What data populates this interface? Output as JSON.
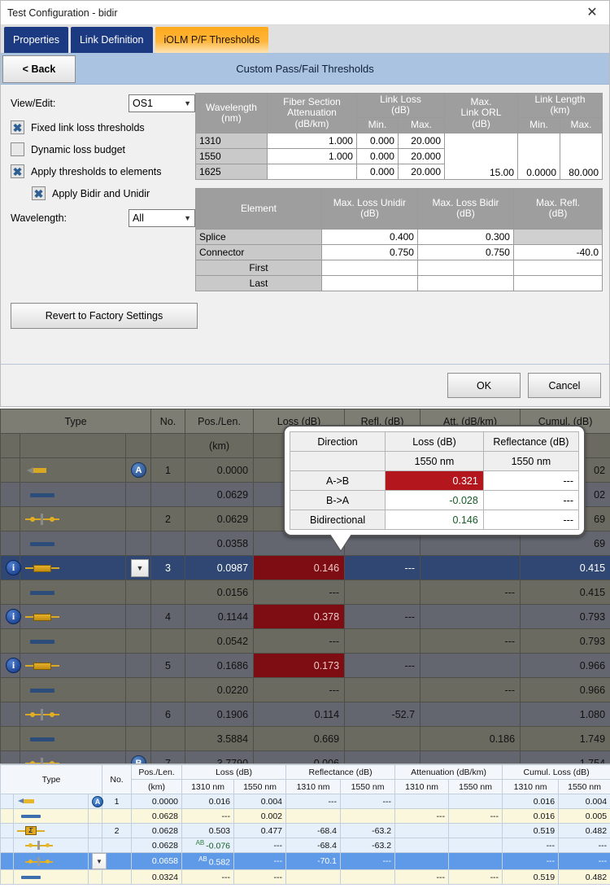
{
  "dialog": {
    "title": "Test Configuration - bidir",
    "close_icon": "close-icon",
    "tabs": [
      {
        "label": "Properties",
        "active": false
      },
      {
        "label": "Link Definition",
        "active": false
      },
      {
        "label": "iOLM P/F Thresholds",
        "active": true
      }
    ],
    "back_label": "< Back",
    "section_title": "Custom Pass/Fail Thresholds",
    "left": {
      "view_edit_label": "View/Edit:",
      "view_edit_value": "OS1",
      "checkboxes": [
        {
          "label": "Fixed link loss thresholds",
          "checked": true,
          "indent": false
        },
        {
          "label": "Dynamic loss budget",
          "checked": false,
          "indent": false
        },
        {
          "label": "Apply thresholds to elements",
          "checked": true,
          "indent": false
        },
        {
          "label": "Apply Bidir and Unidir",
          "checked": true,
          "indent": true
        }
      ],
      "wavelength_label": "Wavelength:",
      "wavelength_value": "All"
    },
    "threshold_table": {
      "headers": {
        "wavelength": "Wavelength\n(nm)",
        "wavelength_l1": "Wavelength",
        "wavelength_l2": "(nm)",
        "fiber_l1": "Fiber Section",
        "fiber_l2": "Attenuation",
        "fiber_l3": "(dB/km)",
        "linkloss_l1": "Link Loss",
        "linkloss_l2": "(dB)",
        "min": "Min.",
        "max": "Max.",
        "orl_l1": "Max.",
        "orl_l2": "Link ORL",
        "orl_l3": "(dB)",
        "length_l1": "Link Length",
        "length_l2": "(km)",
        "length_min": "Min.",
        "length_max": "Max."
      },
      "rows": [
        {
          "wavelength": "1310",
          "attenuation": "1.000",
          "loss_min": "0.000",
          "loss_max": "20.000"
        },
        {
          "wavelength": "1550",
          "attenuation": "1.000",
          "loss_min": "0.000",
          "loss_max": "20.000"
        },
        {
          "wavelength": "1625",
          "attenuation": "",
          "loss_min": "0.000",
          "loss_max": "20.000"
        }
      ],
      "orl": "15.00",
      "length_min": "0.0000",
      "length_max": "80.000"
    },
    "element_table": {
      "headers": {
        "element": "Element",
        "unidir_l1": "Max. Loss Unidir",
        "unidir_l2": "(dB)",
        "bidir_l1": "Max. Loss Bidir",
        "bidir_l2": "(dB)",
        "refl_l1": "Max. Refl.",
        "refl_l2": "(dB)"
      },
      "rows": [
        {
          "element": "Splice",
          "unidir": "0.400",
          "bidir": "0.300",
          "refl": "",
          "refl_disabled": true,
          "indent": false
        },
        {
          "element": "Connector",
          "unidir": "0.750",
          "bidir": "0.750",
          "refl": "-40.0",
          "refl_disabled": false,
          "indent": false
        },
        {
          "element": "First",
          "unidir": "",
          "bidir": "",
          "refl": "",
          "refl_disabled": false,
          "indent": true
        },
        {
          "element": "Last",
          "unidir": "",
          "bidir": "",
          "refl": "",
          "refl_disabled": false,
          "indent": true
        }
      ]
    },
    "revert_label": "Revert to Factory Settings",
    "ok_label": "OK",
    "cancel_label": "Cancel"
  },
  "dark_table": {
    "headers": {
      "type": "Type",
      "no": "No.",
      "pos_l1": "Pos./Len.",
      "pos_l2": "(km)",
      "loss": "Loss (dB)",
      "refl": "Refl. (dB)",
      "att": "Att. (dB/km)",
      "cumul": "Cumul. (dB)"
    },
    "rows": [
      {
        "icon": "launch-cable-icon",
        "badge": "A",
        "no": "1",
        "pos": "0.0000",
        "loss": "",
        "refl": "",
        "att": "",
        "cumul": "02",
        "loss_state": "",
        "selected": false,
        "band": "a",
        "hidden_behind_tip": true
      },
      {
        "icon": "fiber-section-icon",
        "badge": "",
        "no": "",
        "pos": "0.0629",
        "loss": "",
        "refl": "",
        "att": "",
        "cumul": "02",
        "loss_state": "",
        "selected": false,
        "band": "b",
        "hidden_behind_tip": true
      },
      {
        "icon": "connector-icon",
        "badge": "",
        "no": "2",
        "pos": "0.0629",
        "loss": "",
        "refl": "",
        "att": "",
        "cumul": "69",
        "loss_state": "",
        "selected": false,
        "band": "a",
        "hidden_behind_tip": true
      },
      {
        "icon": "fiber-section-icon",
        "badge": "",
        "no": "",
        "pos": "0.0358",
        "loss": "",
        "refl": "",
        "att": "",
        "cumul": "69",
        "loss_state": "",
        "selected": false,
        "band": "b",
        "hidden_behind_tip": true
      },
      {
        "icon": "splice-icon",
        "info": true,
        "dropdown": true,
        "badge": "",
        "no": "3",
        "pos": "0.0987",
        "loss": "0.146",
        "refl": "---",
        "att": "",
        "cumul": "0.415",
        "loss_state": "fail",
        "selected": true,
        "band": "sel"
      },
      {
        "icon": "fiber-section-icon",
        "badge": "",
        "no": "",
        "pos": "0.0156",
        "loss": "---",
        "refl": "",
        "att": "---",
        "cumul": "0.415",
        "loss_state": "",
        "selected": false,
        "band": "a"
      },
      {
        "icon": "splice-icon",
        "info": true,
        "badge": "",
        "no": "4",
        "pos": "0.1144",
        "loss": "0.378",
        "refl": "---",
        "att": "",
        "cumul": "0.793",
        "loss_state": "fail",
        "selected": false,
        "band": "b"
      },
      {
        "icon": "fiber-section-icon",
        "badge": "",
        "no": "",
        "pos": "0.0542",
        "loss": "---",
        "refl": "",
        "att": "---",
        "cumul": "0.793",
        "loss_state": "",
        "selected": false,
        "band": "a"
      },
      {
        "icon": "splice-icon",
        "info": true,
        "badge": "",
        "no": "5",
        "pos": "0.1686",
        "loss": "0.173",
        "refl": "---",
        "att": "",
        "cumul": "0.966",
        "loss_state": "fail",
        "selected": false,
        "band": "b"
      },
      {
        "icon": "fiber-section-icon",
        "badge": "",
        "no": "",
        "pos": "0.0220",
        "loss": "---",
        "refl": "",
        "att": "---",
        "cumul": "0.966",
        "loss_state": "",
        "selected": false,
        "band": "a"
      },
      {
        "icon": "connector-icon",
        "badge": "",
        "no": "6",
        "pos": "0.1906",
        "loss": "0.114",
        "refl": "-52.7",
        "att": "",
        "cumul": "1.080",
        "loss_state": "pass",
        "selected": false,
        "band": "b"
      },
      {
        "icon": "fiber-section-icon",
        "badge": "",
        "no": "",
        "pos": "3.5884",
        "loss": "0.669",
        "refl": "",
        "att": "0.186",
        "cumul": "1.749",
        "loss_state": "",
        "selected": false,
        "band": "a"
      },
      {
        "icon": "connector-icon",
        "badge": "B",
        "no": "7",
        "pos": "3.7790",
        "loss": "0.006",
        "refl": "---",
        "att": "",
        "cumul": "1.754",
        "loss_state": "pass",
        "selected": false,
        "band": "b"
      }
    ]
  },
  "tooltip": {
    "headers": {
      "direction": "Direction",
      "loss": "Loss (dB)",
      "reflectance": "Reflectance (dB)"
    },
    "subheaders": {
      "loss_wl": "1550 nm",
      "refl_wl": "1550 nm"
    },
    "rows": [
      {
        "direction": "A->B",
        "loss": "0.321",
        "loss_state": "fail",
        "reflectance": "---"
      },
      {
        "direction": "B->A",
        "loss": "-0.028",
        "loss_state": "pass",
        "reflectance": "---"
      },
      {
        "direction": "Bidirectional",
        "loss": "0.146",
        "loss_state": "pass",
        "reflectance": "---"
      }
    ]
  },
  "light_table": {
    "headers": {
      "type": "Type",
      "no": "No.",
      "pos_l1": "Pos./Len.",
      "pos_l2": "(km)",
      "loss": "Loss (dB)",
      "refl": "Reflectance (dB)",
      "att": "Attenuation (dB/km)",
      "cumul": "Cumul. Loss (dB)",
      "wl1": "1310 nm",
      "wl2": "1550 nm"
    },
    "rows": [
      {
        "icon": "launch-cable-icon",
        "badge": "A",
        "no": "1",
        "pos": "0.0000",
        "loss1310": "0.016",
        "loss1550": "0.004",
        "refl1310": "---",
        "refl1550": "---",
        "att1310": "",
        "att1550": "",
        "cum1310": "0.016",
        "cum1550": "0.004",
        "band": "blue",
        "selected": false,
        "ab1310": false,
        "ab1550": false,
        "green1310": true,
        "green1550": true
      },
      {
        "icon": "fiber-section-icon",
        "badge": "",
        "no": "",
        "pos": "0.0628",
        "loss1310": "---",
        "loss1550": "0.002",
        "refl1310": "",
        "refl1550": "",
        "att1310": "---",
        "att1550": "---",
        "cum1310": "0.016",
        "cum1550": "0.005",
        "band": "cream",
        "selected": false,
        "ab1310": false,
        "ab1550": false,
        "green1310": false,
        "green1550": false
      },
      {
        "icon": "macrobend-icon",
        "badge": "",
        "no": "2",
        "pos": "0.0628",
        "loss1310": "0.503",
        "loss1550": "0.477",
        "refl1310": "-68.4",
        "refl1550": "-63.2",
        "att1310": "",
        "att1550": "",
        "cum1310": "0.519",
        "cum1550": "0.482",
        "band": "blue",
        "selected": false,
        "ab1310": false,
        "ab1550": false,
        "green1310": true,
        "green1550": true
      },
      {
        "icon": "connector-icon",
        "badge": "",
        "no": "",
        "pos": "0.0628",
        "loss1310": "-0.076",
        "loss1550": "---",
        "refl1310": "-68.4",
        "refl1550": "-63.2",
        "att1310": "",
        "att1550": "",
        "cum1310": "---",
        "cum1550": "---",
        "band": "blue",
        "selected": false,
        "ab1310": true,
        "ab1550": false,
        "green1310": true,
        "green1550": false,
        "indent": true
      },
      {
        "icon": "connector-icon",
        "badge": "",
        "no": "",
        "pos": "0.0658",
        "loss1310": "0.582",
        "loss1550": "---",
        "refl1310": "-70.1",
        "refl1550": "---",
        "att1310": "",
        "att1550": "",
        "cum1310": "---",
        "cum1550": "---",
        "band": "sel",
        "selected": true,
        "ab1310": true,
        "ab1550": false,
        "green1310": true,
        "green1550": false,
        "indent": true,
        "dropdown": true
      },
      {
        "icon": "fiber-section-icon",
        "badge": "",
        "no": "",
        "pos": "0.0324",
        "loss1310": "---",
        "loss1550": "---",
        "refl1310": "",
        "refl1550": "",
        "att1310": "---",
        "att1550": "---",
        "cum1310": "0.519",
        "cum1550": "0.482",
        "band": "cream",
        "selected": false,
        "ab1310": false,
        "ab1550": false,
        "green1310": false,
        "green1550": false
      }
    ]
  }
}
